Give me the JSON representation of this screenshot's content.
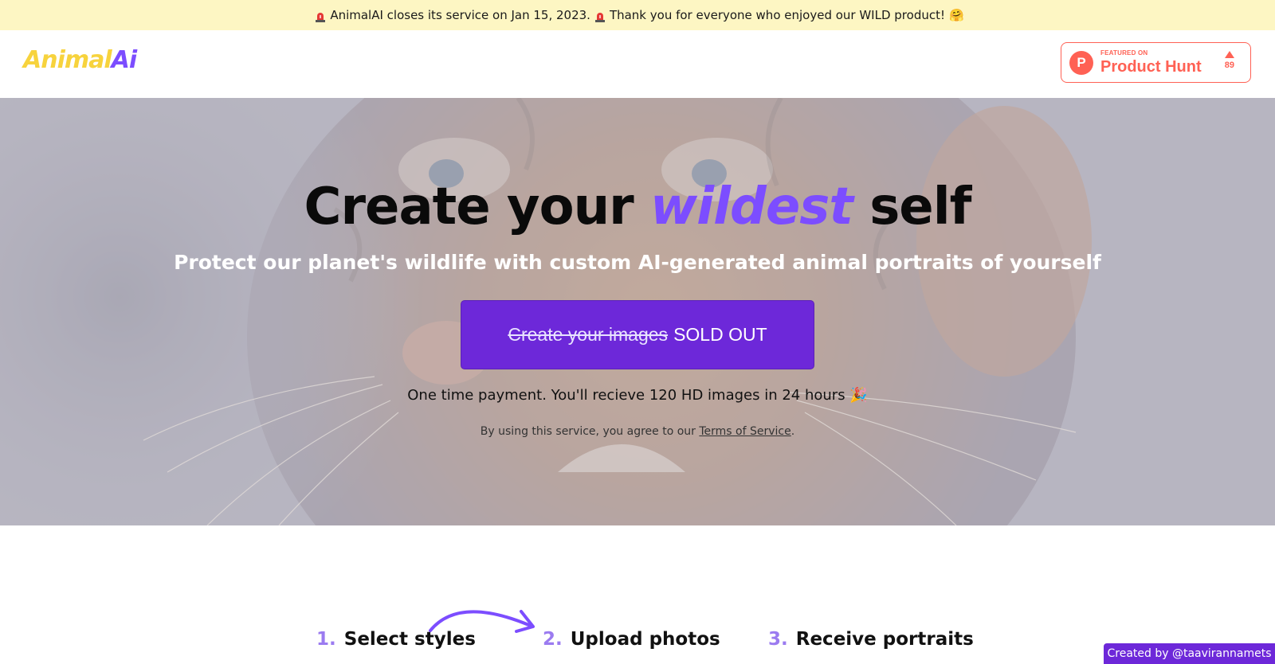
{
  "banner": {
    "text_before": "AnimalAI closes its service on Jan 15, 2023.",
    "text_after": "Thank you for everyone who enjoyed our WILD product!",
    "emoji_end": "🤗"
  },
  "header": {
    "logo_part1": "Animal",
    "logo_part2": "Ai",
    "producthunt": {
      "featured_label": "FEATURED ON",
      "name": "Product Hunt",
      "votes": "89",
      "letter": "P"
    }
  },
  "hero": {
    "title_before": "Create your ",
    "title_highlight": "wildest",
    "title_after": " self",
    "subtitle": "Protect our planet's wildlife with custom AI-generated animal portraits of yourself",
    "cta_strikethrough": "Create your images",
    "cta_status": "SOLD OUT",
    "payment_note": "One time payment. You'll recieve 120 HD images in 24 hours 🎉",
    "terms_prefix": "By using this service, you agree to our ",
    "terms_link": "Terms of Service",
    "terms_suffix": "."
  },
  "steps": [
    {
      "num": "1.",
      "label": "Select styles"
    },
    {
      "num": "2.",
      "label": "Upload photos"
    },
    {
      "num": "3.",
      "label": "Receive portraits"
    }
  ],
  "credit": "Created by @taavirannamets",
  "colors": {
    "accent": "#7c4dff",
    "button": "#6d28d9",
    "banner_bg": "#fdf6c3",
    "logo_yellow": "#f7d33d",
    "producthunt": "#ff6154"
  }
}
